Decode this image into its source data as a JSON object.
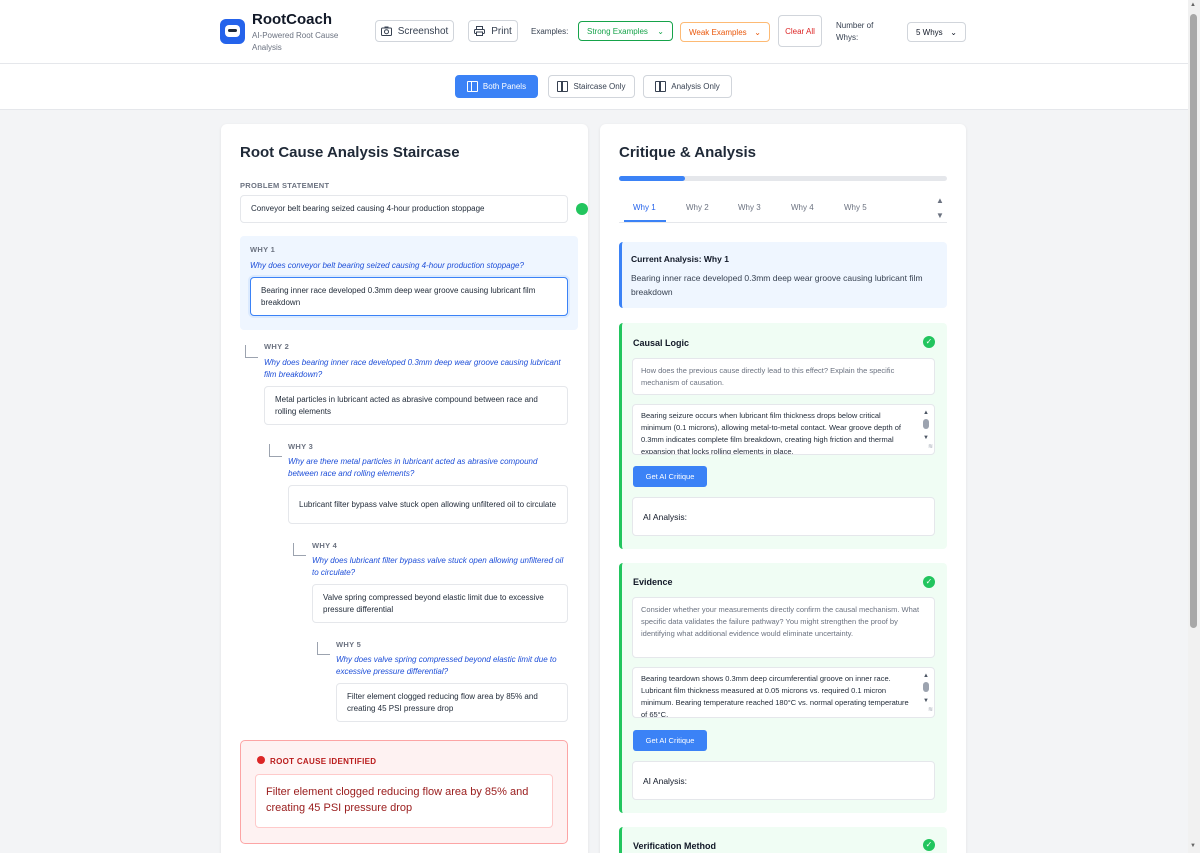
{
  "header": {
    "app_title": "RootCoach",
    "app_subtitle": "AI-Powered Root Cause Analysis",
    "screenshot_label": "Screenshot",
    "print_label": "Print",
    "examples_label": "Examples:",
    "strong_examples": "Strong Examples",
    "weak_examples": "Weak Examples",
    "clear_label": "Clear All",
    "whys_label": "Number of Whys:",
    "whys_value": "5 Whys",
    "colors": {
      "strong": "#16a34a",
      "weak": "#ea580c",
      "clear": "#dc2626"
    }
  },
  "view_toggle": {
    "both": "Both Panels",
    "staircase": "Staircase Only",
    "analysis": "Analysis Only",
    "active": "both"
  },
  "staircase": {
    "title": "Root Cause Analysis Staircase",
    "problem_label": "PROBLEM STATEMENT",
    "problem_value": "Conveyor belt bearing seized causing 4-hour production stoppage",
    "whys": [
      {
        "label": "WHY 1",
        "question": "Why does conveyor belt bearing seized causing 4-hour production stoppage?",
        "answer": "Bearing inner race developed 0.3mm deep wear groove causing lubricant film breakdown"
      },
      {
        "label": "WHY 2",
        "question": "Why does bearing inner race developed 0.3mm deep wear groove causing lubricant film breakdown?",
        "answer": "Metal particles in lubricant acted as abrasive compound between race and rolling elements"
      },
      {
        "label": "WHY 3",
        "question": "Why are there metal particles in lubricant acted as abrasive compound between race and rolling elements?",
        "answer": "Lubricant filter bypass valve stuck open allowing unfiltered oil to circulate"
      },
      {
        "label": "WHY 4",
        "question": "Why does lubricant filter bypass valve stuck open allowing unfiltered oil to circulate?",
        "answer": "Valve spring compressed beyond elastic limit due to excessive pressure differential"
      },
      {
        "label": "WHY 5",
        "question": "Why does valve spring compressed beyond elastic limit due to excessive pressure differential?",
        "answer": "Filter element clogged reducing flow area by 85% and creating 45 PSI pressure drop"
      }
    ],
    "root_label": "ROOT CAUSE IDENTIFIED",
    "root_value": "Filter element clogged reducing flow area by 85% and creating 45 PSI pressure drop"
  },
  "analysis": {
    "title": "Critique & Analysis",
    "progress": 0.2,
    "tabs": [
      "Why 1",
      "Why 2",
      "Why 3",
      "Why 4",
      "Why 5"
    ],
    "active_tab": "Why 1",
    "current_title": "Current Analysis: Why 1",
    "current_text": "Bearing inner race developed 0.3mm deep wear groove causing lubricant film breakdown",
    "sections": [
      {
        "title": "Causal Logic",
        "hint": "How does the previous cause directly lead to this effect? Explain the specific mechanism of causation.",
        "answer": "Bearing seizure occurs when lubricant film thickness drops below critical minimum (0.1 microns), allowing metal-to-metal contact. Wear groove depth of 0.3mm indicates complete film breakdown, creating high friction and thermal expansion that locks rolling elements in place.",
        "button": "Get AI Critique",
        "ai_label": "AI Analysis:"
      },
      {
        "title": "Evidence",
        "hint": "Consider whether your measurements directly confirm the causal mechanism. What specific data validates the failure pathway? You might strengthen the proof by identifying what additional evidence would eliminate uncertainty.",
        "answer": "Bearing teardown shows 0.3mm deep circumferential groove on inner race. Lubricant film thickness measured at 0.05 microns vs. required 0.1 micron minimum. Bearing temperature reached 180°C vs. normal operating temperature of 65°C.",
        "button": "Get AI Critique",
        "ai_label": "AI Analysis:"
      },
      {
        "title": "Verification Method"
      }
    ]
  }
}
